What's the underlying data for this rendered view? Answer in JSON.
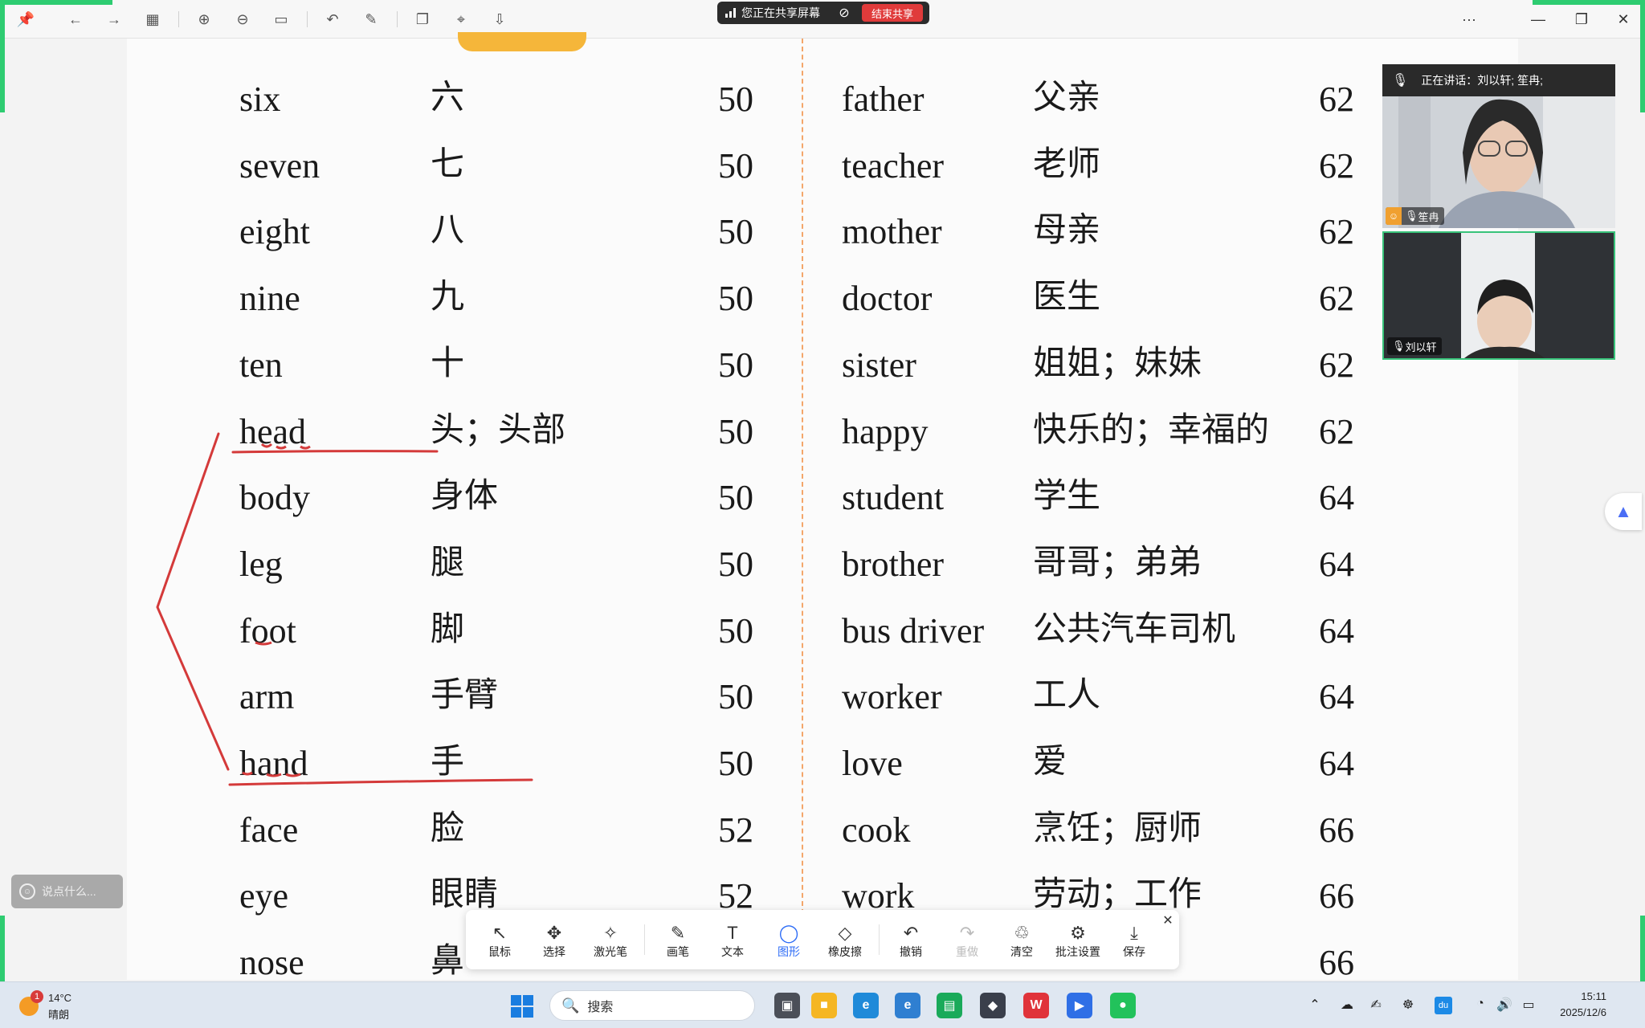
{
  "toolbar": {
    "icons": [
      "pin-icon",
      "back-icon",
      "forward-icon",
      "grid-icon",
      "zoom-in-icon",
      "zoom-out-icon",
      "fit-width-icon",
      "rotate-icon",
      "edit-icon",
      "copy-icon",
      "crop-icon",
      "export-icon"
    ],
    "more": "···",
    "minimize": "—",
    "restore": "❐",
    "close": "✕"
  },
  "share": {
    "status": "您正在共享屏幕",
    "end_label": "结束共享"
  },
  "vocab": {
    "left": [
      {
        "word": "six",
        "cn": "六",
        "page": "50"
      },
      {
        "word": "seven",
        "cn": "七",
        "page": "50"
      },
      {
        "word": "eight",
        "cn": "八",
        "page": "50"
      },
      {
        "word": "nine",
        "cn": "九",
        "page": "50"
      },
      {
        "word": "ten",
        "cn": "十",
        "page": "50"
      },
      {
        "word": "head",
        "cn": "头；头部",
        "page": "50"
      },
      {
        "word": "body",
        "cn": "身体",
        "page": "50"
      },
      {
        "word": "leg",
        "cn": "腿",
        "page": "50"
      },
      {
        "word": "foot",
        "cn": "脚",
        "page": "50"
      },
      {
        "word": "arm",
        "cn": "手臂",
        "page": "50"
      },
      {
        "word": "hand",
        "cn": "手",
        "page": "50"
      },
      {
        "word": "face",
        "cn": "脸",
        "page": "52"
      },
      {
        "word": "eye",
        "cn": "眼睛",
        "page": "52"
      },
      {
        "word": "nose",
        "cn": "鼻",
        "page": ""
      }
    ],
    "right": [
      {
        "word": "father",
        "cn": "父亲",
        "page": "62"
      },
      {
        "word": "teacher",
        "cn": "老师",
        "page": "62"
      },
      {
        "word": "mother",
        "cn": "母亲",
        "page": "62"
      },
      {
        "word": "doctor",
        "cn": "医生",
        "page": "62"
      },
      {
        "word": "sister",
        "cn": "姐姐；妹妹",
        "page": "62"
      },
      {
        "word": "happy",
        "cn": "快乐的；幸福的",
        "page": "62"
      },
      {
        "word": "student",
        "cn": "学生",
        "page": "64"
      },
      {
        "word": "brother",
        "cn": "哥哥；弟弟",
        "page": "64"
      },
      {
        "word": "bus driver",
        "cn": "公共汽车司机",
        "page": "64"
      },
      {
        "word": "worker",
        "cn": "工人",
        "page": "64"
      },
      {
        "word": "love",
        "cn": "爱",
        "page": "64"
      },
      {
        "word": "cook",
        "cn": "烹饪；厨师",
        "page": "66"
      },
      {
        "word": "work",
        "cn": "劳动；工作",
        "page": "66"
      },
      {
        "word": "",
        "cn": "",
        "page": "66"
      }
    ]
  },
  "video": {
    "speaking_label": "正在讲话：刘以轩; 笙冉;",
    "participant1": "笙冉",
    "participant2": "刘以轩"
  },
  "chat": {
    "placeholder": "说点什么..."
  },
  "annotation_toolbar": {
    "items": [
      {
        "label": "鼠标",
        "icon": "cursor-icon"
      },
      {
        "label": "选择",
        "icon": "move-icon"
      },
      {
        "label": "激光笔",
        "icon": "laser-pen-icon"
      },
      {
        "label": "画笔",
        "icon": "pen-icon"
      },
      {
        "label": "文本",
        "icon": "text-icon"
      },
      {
        "label": "图形",
        "icon": "shape-icon"
      },
      {
        "label": "橡皮擦",
        "icon": "eraser-icon"
      },
      {
        "label": "撤销",
        "icon": "undo-icon"
      },
      {
        "label": "重做",
        "icon": "redo-icon"
      },
      {
        "label": "清空",
        "icon": "trash-icon"
      },
      {
        "label": "批注设置",
        "icon": "settings-icon"
      },
      {
        "label": "保存",
        "icon": "download-icon"
      }
    ],
    "active": "图形",
    "disabled": "重做"
  },
  "taskbar": {
    "weather_temp": "14°C",
    "weather_cond": "晴朗",
    "weather_badge": "1",
    "search_label": "搜索",
    "time": "15:11",
    "date": "2025/12/6"
  },
  "colors": {
    "accent": "#2d6cf6",
    "annotation_red": "#d43a3a",
    "end_share": "#e03b3b",
    "active_speaker_border": "#38c37a",
    "column_divider": "#f4a66a"
  }
}
